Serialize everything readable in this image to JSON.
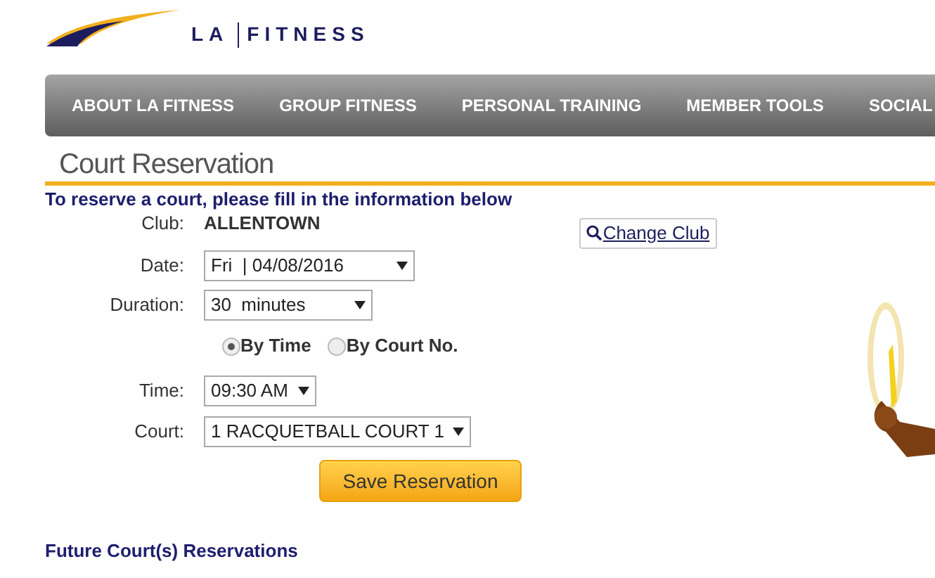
{
  "logo": {
    "left": "LA",
    "right": "FITNESS"
  },
  "nav": [
    {
      "label": "ABOUT LA FITNESS"
    },
    {
      "label": "GROUP FITNESS"
    },
    {
      "label": "PERSONAL TRAINING"
    },
    {
      "label": "MEMBER TOOLS"
    },
    {
      "label": "SOCIAL"
    }
  ],
  "page_title": "Court Reservation",
  "intro": "To reserve a court, please fill in the information below",
  "club": {
    "label": "Club:",
    "value": "ALLENTOWN",
    "button": "Change Club"
  },
  "fields": [
    {
      "label": "Date:",
      "value": "Fri  | 04/08/2016"
    },
    {
      "label": "Duration:",
      "value": "30  minutes"
    }
  ],
  "mode": [
    {
      "label": "By Time",
      "selected": true
    },
    {
      "label": "By Court No.",
      "selected": false
    }
  ],
  "fields2": [
    {
      "label": "Time:",
      "value": "09:30 AM"
    },
    {
      "label": "Court:",
      "value": "1 RACQUETBALL COURT 1"
    }
  ],
  "save_button": "Save Reservation",
  "future_heading": "Future Court(s) Reservations"
}
